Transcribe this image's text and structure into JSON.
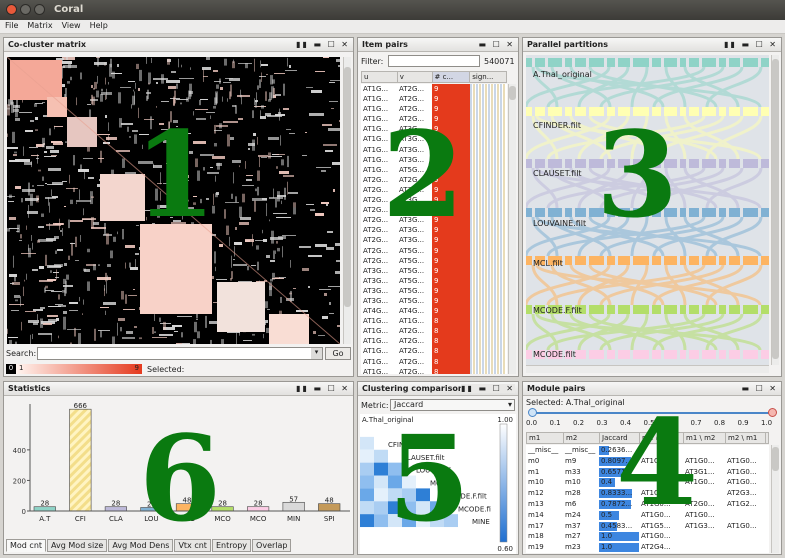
{
  "window": {
    "title": "Coral"
  },
  "menu": [
    "File",
    "Matrix",
    "View",
    "Help"
  ],
  "panels": {
    "cocluster": {
      "title": "Co-cluster matrix",
      "search_label": "Search:",
      "go": "Go",
      "legend": [
        "0",
        "1",
        "9"
      ],
      "selected_label": "Selected:",
      "big": "1"
    },
    "itempairs": {
      "title": "Item pairs",
      "filter_label": "Filter:",
      "count": "540071",
      "columns": [
        "u",
        "v",
        "# c...",
        "sign..."
      ],
      "rows": [
        [
          "AT1G...",
          "AT2G...",
          "9"
        ],
        [
          "AT1G...",
          "AT2G...",
          "9"
        ],
        [
          "AT1G...",
          "AT2G...",
          "9"
        ],
        [
          "AT1G...",
          "AT2G...",
          "9"
        ],
        [
          "AT1G...",
          "AT3G...",
          "9"
        ],
        [
          "AT1G...",
          "AT3G...",
          "9"
        ],
        [
          "AT1G...",
          "AT3G...",
          "9"
        ],
        [
          "AT1G...",
          "AT3G...",
          "9"
        ],
        [
          "AT1G...",
          "AT5G...",
          "9"
        ],
        [
          "AT2G...",
          "AT2G...",
          "9"
        ],
        [
          "AT2G...",
          "AT3G...",
          "9"
        ],
        [
          "AT2G...",
          "AT3G...",
          "9"
        ],
        [
          "AT2G...",
          "AT3G...",
          "9"
        ],
        [
          "AT2G...",
          "AT3G...",
          "9"
        ],
        [
          "AT2G...",
          "AT3G...",
          "9"
        ],
        [
          "AT2G...",
          "AT3G...",
          "9"
        ],
        [
          "AT2G...",
          "AT5G...",
          "9"
        ],
        [
          "AT2G...",
          "AT5G...",
          "9"
        ],
        [
          "AT3G...",
          "AT5G...",
          "9"
        ],
        [
          "AT3G...",
          "AT5G...",
          "9"
        ],
        [
          "AT3G...",
          "AT5G...",
          "9"
        ],
        [
          "AT3G...",
          "AT5G...",
          "9"
        ],
        [
          "AT4G...",
          "AT4G...",
          "9"
        ],
        [
          "AT1G...",
          "AT1G...",
          "8"
        ],
        [
          "AT1G...",
          "AT2G...",
          "8"
        ],
        [
          "AT1G...",
          "AT2G...",
          "8"
        ],
        [
          "AT1G...",
          "AT2G...",
          "8"
        ],
        [
          "AT1G...",
          "AT2G...",
          "8"
        ],
        [
          "AT1G...",
          "AT2G...",
          "8"
        ],
        [
          "AT1G...",
          "AT2G...",
          "8"
        ],
        [
          "AT1G...",
          "AT2G...",
          "8"
        ]
      ],
      "big": "2"
    },
    "parallel": {
      "title": "Parallel partitions",
      "labels": [
        "A.Thal_original",
        "CFINDER.filt",
        "CLAUSET.filt",
        "LOUVAINE.filt",
        "MCL.filt",
        "MCODE.F.filt",
        "MCODE.filt"
      ],
      "colors": [
        "#8fd3c7",
        "#ffffb3",
        "#bebada",
        "#80b1d3",
        "#fdb462",
        "#b3de69",
        "#fccde5"
      ],
      "big": "3"
    },
    "modulepairs": {
      "title": "Module pairs",
      "selected": "Selected: A.Thal_original",
      "ticks": [
        "0.0",
        "0.1",
        "0.2",
        "0.3",
        "0.4",
        "0.5",
        "0.6",
        "0.7",
        "0.8",
        "0.9",
        "1.0"
      ],
      "columns": [
        "m1",
        "m2",
        "Jaccard",
        "m1 ∩ m2",
        "m1 \\ m2",
        "m2 \\ m1"
      ],
      "rows": [
        [
          "__misc__",
          "__misc__",
          "0.2636...",
          "",
          "",
          ""
        ],
        [
          "m0",
          "m9",
          "0.8097...",
          "AT1G0...",
          "AT1G0...",
          "AT1G0..."
        ],
        [
          "m1",
          "m33",
          "0.6571...",
          "",
          "AT3G1...",
          "AT1G0..."
        ],
        [
          "m10",
          "m10",
          "0.4",
          "",
          "AT1G0...",
          "AT1G0..."
        ],
        [
          "m12",
          "m28",
          "0.8333...",
          "AT1G0...",
          "",
          "AT2G3..."
        ],
        [
          "m13",
          "m6",
          "0.7872...",
          "AT1G0...",
          "AT2G0...",
          "AT1G2..."
        ],
        [
          "m14",
          "m24",
          "0.5",
          "AT1G0...",
          "AT1G0...",
          ""
        ],
        [
          "m17",
          "m37",
          "0.4583...",
          "AT1G5...",
          "AT1G3...",
          "AT1G0..."
        ],
        [
          "m18",
          "m27",
          "1.0",
          "AT1G0...",
          "",
          ""
        ],
        [
          "m19",
          "m23",
          "1.0",
          "AT2G4...",
          "",
          ""
        ]
      ],
      "jaccard": [
        0.26,
        0.81,
        0.66,
        0.4,
        0.83,
        0.79,
        0.5,
        0.46,
        1.0,
        1.0
      ],
      "big": "4"
    },
    "clustering": {
      "title": "Clustering comparison",
      "metric_label": "Metric:",
      "metric": "Jaccard",
      "labels": [
        "A.Thal_original",
        "CFINDER.filt",
        "CLAUSET.filt",
        "LOUVAINE",
        "MCL.filt",
        "MCODE.F.filt",
        "MCODE.fi",
        "MINE"
      ],
      "scale_top": "1.00",
      "scale_bottom": "0.60",
      "big": "5"
    },
    "statistics": {
      "title": "Statistics",
      "yticks": [
        "400",
        "200",
        "0"
      ],
      "tabs": [
        "Mod cnt",
        "Avg Mod size",
        "Avg Mod Dens",
        "Vtx cnt",
        "Entropy",
        "Overlap"
      ],
      "big": "6"
    }
  },
  "chart_data": {
    "type": "bar",
    "categories": [
      "A.T",
      "CFI",
      "CLA",
      "LOU",
      "MCL",
      "MCO",
      "MCO",
      "MIN",
      "SPI"
    ],
    "values": [
      28,
      666,
      28,
      23,
      48,
      28,
      28,
      57,
      48
    ],
    "ylim": [
      0,
      700
    ],
    "colors": [
      "#8fd3c7",
      "#ffffb3",
      "#bebada",
      "#80b1d3",
      "#fdb462",
      "#b3de69",
      "#fccde5",
      "#d9d9d9",
      "#c49a5a"
    ]
  }
}
